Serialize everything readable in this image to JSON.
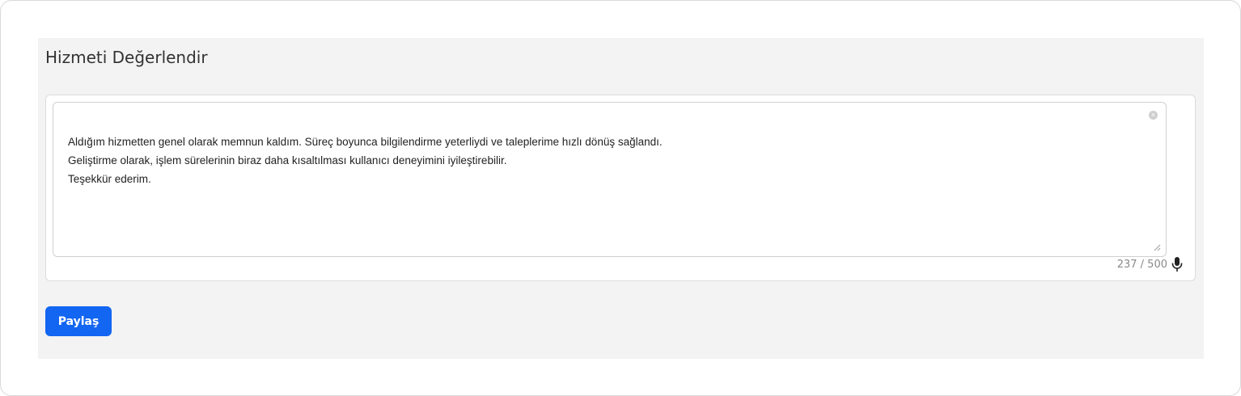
{
  "panel": {
    "title": "Hizmeti Değerlendir"
  },
  "feedback": {
    "text": "Aldığım hizmetten genel olarak memnun kaldım. Süreç boyunca bilgilendirme yeterliydi ve taleplerime hızlı dönüş sağlandı.\nGeliştirme olarak, işlem sürelerinin biraz daha kısaltılması kullanıcı deneyimini iyileştirebilir.\nTeşekkür ederim.",
    "counter": "237 / 500",
    "clear_icon_glyph": "×"
  },
  "icons": {
    "clear": "clear-icon",
    "resize": "resize-handle-icon",
    "mic": "microphone-icon"
  },
  "actions": {
    "share_label": "Paylaş"
  },
  "colors": {
    "accent": "#1266f1",
    "panel_bg": "#f3f3f3"
  }
}
